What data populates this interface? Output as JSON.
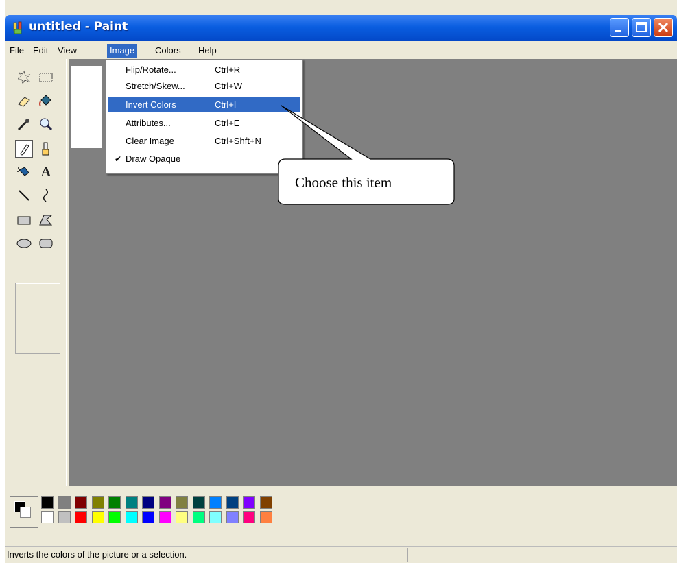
{
  "window": {
    "title": "untitled - Paint"
  },
  "menubar": [
    "File",
    "Edit",
    "View",
    "Image",
    "Colors",
    "Help"
  ],
  "active_menu": "Image",
  "image_menu": [
    {
      "label": "Flip/Rotate...",
      "shortcut": "Ctrl+R"
    },
    {
      "label": "Stretch/Skew...",
      "shortcut": "Ctrl+W"
    },
    {
      "label": "Invert Colors",
      "shortcut": "Ctrl+I",
      "highlighted": true
    },
    {
      "label": "Attributes...",
      "shortcut": "Ctrl+E"
    },
    {
      "label": "Clear Image",
      "shortcut": "Ctrl+Shft+N"
    },
    {
      "label": "Draw Opaque",
      "shortcut": "",
      "checked": true
    }
  ],
  "callout": {
    "text": "Choose this item"
  },
  "tools": [
    "free-form-select-icon",
    "select-icon",
    "eraser-icon",
    "fill-icon",
    "color-picker-icon",
    "magnifier-icon",
    "pencil-icon",
    "brush-icon",
    "airbrush-icon",
    "text-icon",
    "line-icon",
    "curve-icon",
    "rectangle-icon",
    "polygon-icon",
    "ellipse-icon",
    "rounded-rectangle-icon"
  ],
  "selected_tool": "pencil-icon",
  "palette": {
    "top": [
      "#000000",
      "#808080",
      "#800000",
      "#808000",
      "#008000",
      "#008080",
      "#000080",
      "#800080",
      "#808040",
      "#004040",
      "#0080ff",
      "#004080",
      "#8000ff",
      "#804000"
    ],
    "bottom": [
      "#ffffff",
      "#c0c0c0",
      "#ff0000",
      "#ffff00",
      "#00ff00",
      "#00ffff",
      "#0000ff",
      "#ff00ff",
      "#ffff80",
      "#00ff80",
      "#80ffff",
      "#8080ff",
      "#ff0080",
      "#ff8040"
    ]
  },
  "status": {
    "text": "Inverts the colors of the picture or a selection."
  },
  "colors": {
    "titlebar": "#0a5ee0",
    "highlight": "#316ac5",
    "workspace": "#808080",
    "chrome": "#ece9d8"
  }
}
